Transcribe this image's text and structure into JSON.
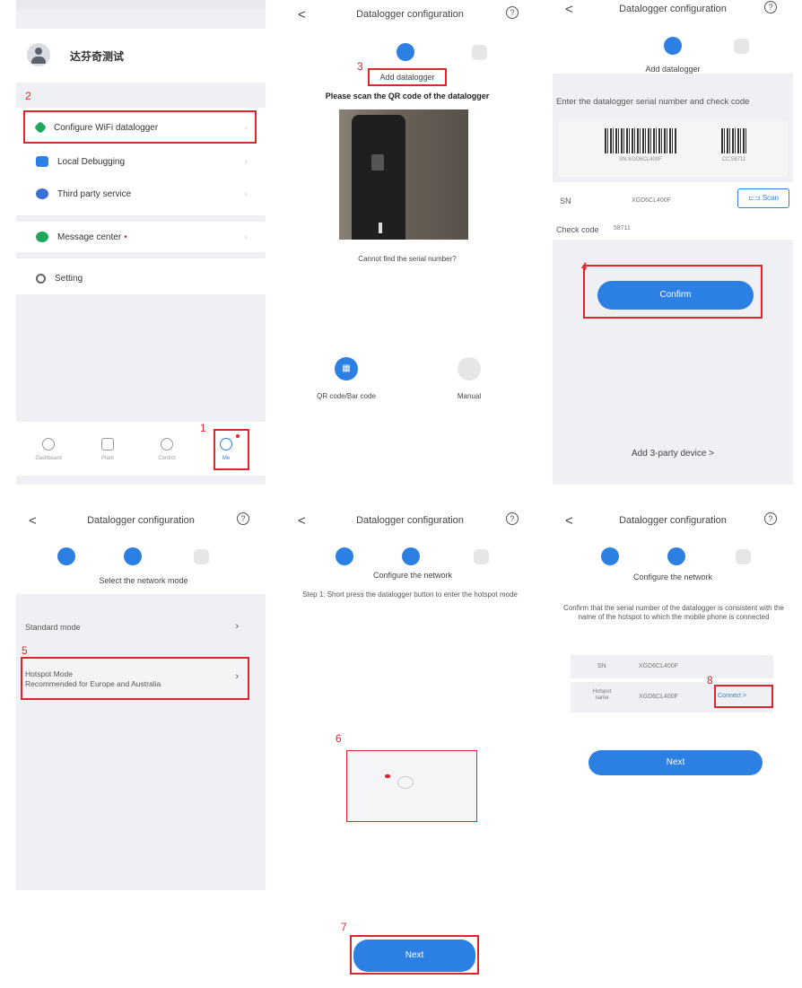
{
  "colors": {
    "accent": "#2c7fe3",
    "highlight": "#e0242b",
    "background_grey": "#eef0f3"
  },
  "panel_me": {
    "username": "达芬奇测试",
    "menu": [
      {
        "label": "Configure WiFi datalogger",
        "icon": "datalogger-icon"
      },
      {
        "label": "Local Debugging",
        "icon": "debug-icon"
      },
      {
        "label": "Third party service",
        "icon": "heart-icon"
      },
      {
        "label": "Message center",
        "icon": "message-icon"
      },
      {
        "label": "Setting",
        "icon": "gear-icon"
      }
    ],
    "bottom_nav": [
      "Dashboard",
      "Plant",
      "Control",
      "Me"
    ],
    "marker_1": "1",
    "marker_2": "2"
  },
  "header": {
    "title": "Datalogger configuration",
    "back": "<",
    "help": "?"
  },
  "panel_scan": {
    "step_label": "Add datalogger",
    "instruction": "Please scan the QR code of the datalogger",
    "cannot_find": "Cannot find the serial number?",
    "options": [
      "QR code/Bar code",
      "Manual"
    ],
    "marker_3": "3"
  },
  "panel_manual": {
    "step_label": "Add datalogger",
    "instruction": "Enter the datalogger serial number and check code",
    "barcode_captions": [
      "SN:XGD6CL400F",
      "CC:58711"
    ],
    "sn_label": "SN",
    "sn_value": "XGD6CL400F",
    "scan_label": "Scan",
    "check_label": "Check code",
    "check_value": "58711",
    "confirm": "Confirm",
    "third_party": "Add 3-party device  >",
    "marker_4": "4"
  },
  "panel_network": {
    "step_label": "Select the network mode",
    "standard": "Standard mode",
    "hotspot_title": "Hotspot Mode",
    "hotspot_sub": "Recommended for Europe and Australia",
    "marker_5": "5"
  },
  "panel_hotspot": {
    "step_label": "Configure the network",
    "instruction": "Step 1: Short press the datalogger button to enter the hotspot mode",
    "next": "Next",
    "marker_6": "6",
    "marker_7": "7"
  },
  "panel_confirm": {
    "step_label": "Configure the network",
    "instruction": "Confirm that the serial number of the datalogger is consistent with the name of the hotspot to which the mobile phone is connected",
    "sn_label": "SN",
    "sn_value": "XGD6CL400F",
    "hotspot_label": "Hotspot name",
    "hotspot_value": "XGD6CL400F",
    "connect": "Connect  >",
    "next": "Next",
    "marker_8": "8"
  }
}
